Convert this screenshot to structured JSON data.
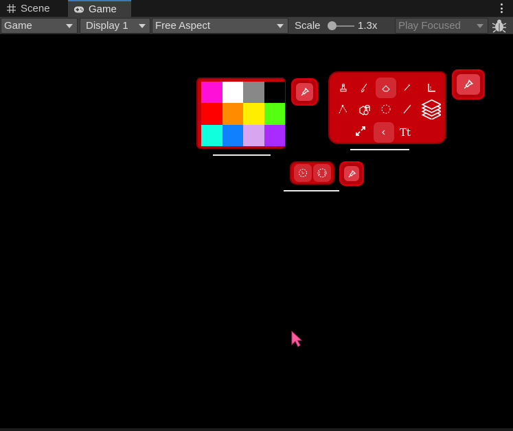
{
  "tabs": [
    {
      "label": "Scene",
      "icon": "grid-icon",
      "active": false
    },
    {
      "label": "Game",
      "icon": "gamepad-icon",
      "active": true
    }
  ],
  "toolbar": {
    "view_mode": "Game",
    "display": "Display 1",
    "aspect": "Free Aspect",
    "scale_label": "Scale",
    "scale_value": "1.3x",
    "scale_fraction": 0.1,
    "play_mode": "Play Focused"
  },
  "palette": {
    "colors": [
      "#ff10d6",
      "#ffffff",
      "#888888",
      "#000000",
      "#ff0000",
      "#ff8c00",
      "#ffee00",
      "#55ff10",
      "#10ffdd",
      "#1180ff",
      "#d8a5f0",
      "#aa2bff"
    ]
  },
  "tool_panel": {
    "tools": [
      {
        "icon": "stamp-icon"
      },
      {
        "icon": "brush-icon"
      },
      {
        "icon": "eraser-icon"
      },
      {
        "icon": "pen-icon"
      },
      {
        "icon": "ruler-corner-icon"
      },
      {
        "icon": "polyline-icon"
      },
      {
        "icon": "primitives-icon"
      },
      {
        "icon": "lasso-icon"
      },
      {
        "icon": "line-icon"
      },
      {
        "icon": "layers-icon"
      },
      {
        "icon": "expand-icon"
      },
      {
        "icon": "chevron-left-icon"
      },
      {
        "icon": "text-icon",
        "label": "Tt"
      }
    ]
  },
  "colors": {
    "panel_red": "#c50008",
    "tab_accent": "#3a79bb",
    "cursor": "#ff5a9e"
  }
}
